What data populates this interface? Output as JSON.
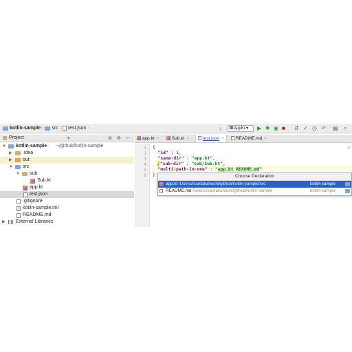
{
  "navbar": {
    "crumbs": [
      "kotlin-sample",
      "src",
      "test.json"
    ],
    "run_config": "AppKt"
  },
  "project": {
    "header": "Project",
    "tree": [
      {
        "label": "kotlin-sample",
        "suffix": "~/github/kotlin-sample",
        "icon": "module-folder"
      },
      {
        "label": ".idea",
        "icon": "folder"
      },
      {
        "label": "out",
        "icon": "folder"
      },
      {
        "label": "src",
        "icon": "source-folder"
      },
      {
        "label": "sub",
        "icon": "folder"
      },
      {
        "label": "Sub.kt",
        "icon": "kotlin-file"
      },
      {
        "label": "app.kt",
        "icon": "kotlin-file"
      },
      {
        "label": "test.json",
        "icon": "json-file"
      },
      {
        "label": ".gitignore",
        "icon": "text-file"
      },
      {
        "label": "kotlin-sample.iml",
        "icon": "iml-file"
      },
      {
        "label": "README.md",
        "icon": "markdown-file"
      },
      {
        "label": "External Libraries",
        "icon": "library"
      }
    ]
  },
  "editor": {
    "tabs": [
      "app.kt",
      "Sub.kt",
      "test.json",
      "README.md"
    ],
    "active_tab": "test.json",
    "line_numbers": [
      "1",
      "2",
      "3",
      "4",
      "5",
      "6"
    ],
    "lines": {
      "l1": "{",
      "l2_key": "\"id\"",
      "l2_rest": " : 1,",
      "l3_key": "\"same-dir\"",
      "l3_mid": " : ",
      "l3_val": "\"app.kt\"",
      "l3_end": ",",
      "l4_key": "\"sub-dir\"",
      "l4_mid": " : ",
      "l4_val": "\"sub/Sub.kt\"",
      "l4_end": ",",
      "l5_key": "\"multi-path-in-one\"",
      "l5_mid": " : ",
      "l5_q1": "\"",
      "l5_v1": "app.kt",
      "l5_sp": " ",
      "l5_v2": "README.md",
      "l5_q2": "\"",
      "l6": "}"
    }
  },
  "popup": {
    "title": "Choose Declaration",
    "items": [
      {
        "name": "app.kt",
        "path": "/Users/isaotakahashi/github/kotlin-sample/src",
        "module": "kotlin-sample"
      },
      {
        "name": "README.md",
        "path": "/Users/isaotakahashi/github/kotlin-sample",
        "module": "kotlin-sample"
      }
    ]
  }
}
